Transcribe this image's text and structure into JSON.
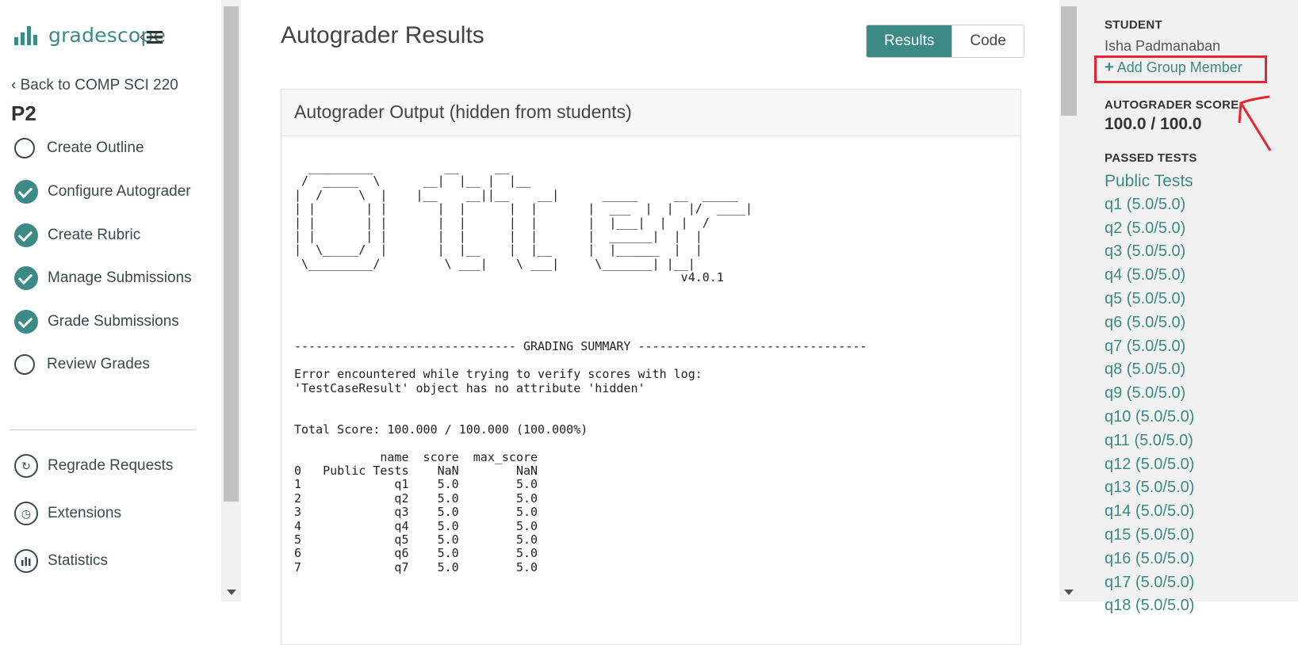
{
  "sidebar": {
    "logo_text": "gradescope",
    "back_link": "Back to COMP SCI 220",
    "assignment_title": "P2",
    "nav_items": [
      {
        "label": "Create Outline",
        "status": "incomplete"
      },
      {
        "label": "Configure Autograder",
        "status": "complete"
      },
      {
        "label": "Create Rubric",
        "status": "complete"
      },
      {
        "label": "Manage Submissions",
        "status": "complete"
      },
      {
        "label": "Grade Submissions",
        "status": "complete"
      },
      {
        "label": "Review Grades",
        "status": "incomplete"
      }
    ],
    "tools": [
      {
        "label": "Regrade Requests",
        "icon": "regrade-icon"
      },
      {
        "label": "Extensions",
        "icon": "clock-icon"
      },
      {
        "label": "Statistics",
        "icon": "bar-chart-icon"
      }
    ]
  },
  "main": {
    "title": "Autograder Results",
    "tabs": {
      "results": "Results",
      "code": "Code"
    },
    "active_tab": "Results",
    "panel_title": "Autograder Output (hidden from students)",
    "output": {
      "banner": "  _________          __     __\n /  _____  \\      __|  |__ |  |__\n|  /     \\  |    |__    __||__    __|      _____     __  _____\n| |       | |       |  |      |  |       |  ___  |  |  |/  ____|\n| |       | |       |  |      |  |       |  |___|  |  |  /\n| |       | |       |  |      |  |       |  ______|  |  |\n|  \\_____/  |       |  |__    |  |__     |  |______  |  |\n \\_________/         \\ ___|    \\ ___|     \\_______| |__|\n                                                      v4.0.1",
      "summary_line": "------------------------------- GRADING SUMMARY --------------------------------",
      "error_line_1": "Error encountered while trying to verify scores with log:",
      "error_line_2": "'TestCaseResult' object has no attribute 'hidden'",
      "total_line": "Total Score: 100.000 / 100.000 (100.000%)",
      "table_header": "            name  score  max_score",
      "table_rows": [
        "0   Public Tests    NaN        NaN",
        "1             q1    5.0        5.0",
        "2             q2    5.0        5.0",
        "3             q3    5.0        5.0",
        "4             q4    5.0        5.0",
        "5             q5    5.0        5.0",
        "6             q6    5.0        5.0",
        "7             q7    5.0        5.0"
      ]
    }
  },
  "right_pane": {
    "student_label": "STUDENT",
    "student_name": "Isha Padmanaban",
    "add_member": "Add Group Member",
    "score_label": "AUTOGRADER SCORE",
    "score": "100.0 / 100.0",
    "passed_label": "PASSED TESTS",
    "passed_tests": [
      "Public Tests",
      "q1 (5.0/5.0)",
      "q2 (5.0/5.0)",
      "q3 (5.0/5.0)",
      "q4 (5.0/5.0)",
      "q5 (5.0/5.0)",
      "q6 (5.0/5.0)",
      "q7 (5.0/5.0)",
      "q8 (5.0/5.0)",
      "q9 (5.0/5.0)",
      "q10 (5.0/5.0)",
      "q11 (5.0/5.0)",
      "q12 (5.0/5.0)",
      "q13 (5.0/5.0)",
      "q14 (5.0/5.0)",
      "q15 (5.0/5.0)",
      "q16 (5.0/5.0)",
      "q17 (5.0/5.0)",
      "q18 (5.0/5.0)"
    ]
  },
  "colors": {
    "accent": "#3c8a85",
    "annotation": "#e8242d"
  }
}
